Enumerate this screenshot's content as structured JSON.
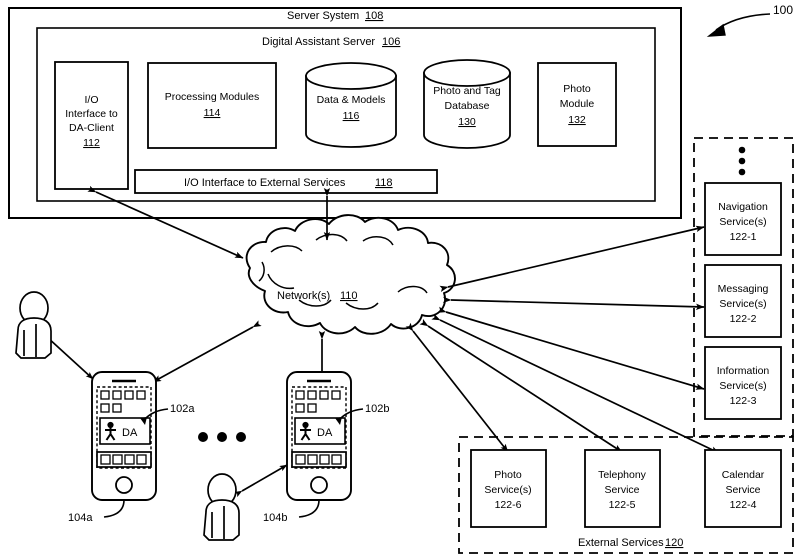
{
  "figure": {
    "number": "100",
    "title_reference": "100"
  },
  "server_system": {
    "label": "Server System",
    "ref": "108"
  },
  "digital_assistant_server": {
    "label": "Digital Assistant Server",
    "ref": "106"
  },
  "da_server_components": [
    {
      "name": "io-interface-da-client",
      "lines": [
        "I/O",
        "Interface to",
        "DA-Client"
      ],
      "ref": "112",
      "shape": "rect"
    },
    {
      "name": "processing-modules",
      "lines": [
        "Processing Modules"
      ],
      "ref": "114",
      "shape": "rect"
    },
    {
      "name": "data-and-models",
      "lines": [
        "Data & Models"
      ],
      "ref": "116",
      "shape": "cylinder"
    },
    {
      "name": "photo-and-tag-database",
      "lines": [
        "Photo and Tag",
        "Database"
      ],
      "ref": "130",
      "shape": "cylinder"
    },
    {
      "name": "photo-module",
      "lines": [
        "Photo",
        "Module"
      ],
      "ref": "132",
      "shape": "rect"
    }
  ],
  "io_interface_external": {
    "label": "I/O Interface to External Services",
    "ref": "118"
  },
  "network": {
    "label": "Network(s)",
    "ref": "110"
  },
  "external_services": {
    "label": "External Services",
    "ref": "120",
    "ellipsis": "vertical-dots",
    "column_services": [
      {
        "name": "navigation-service",
        "lines": [
          "Navigation",
          "Service(s)"
        ],
        "ref": "122-1"
      },
      {
        "name": "messaging-service",
        "lines": [
          "Messaging",
          "Service(s)"
        ],
        "ref": "122-2"
      },
      {
        "name": "information-service",
        "lines": [
          "Information",
          "Service(s)"
        ],
        "ref": "122-3"
      }
    ],
    "row_services": [
      {
        "name": "photo-service",
        "lines": [
          "Photo",
          "Service(s)"
        ],
        "ref": "122-6"
      },
      {
        "name": "telephony-service",
        "lines": [
          "Telephony",
          "Service"
        ],
        "ref": "122-5"
      },
      {
        "name": "calendar-service",
        "lines": [
          "Calendar",
          "Service"
        ],
        "ref": "122-4"
      }
    ]
  },
  "client_devices": [
    {
      "name": "device-a",
      "da_label": "DA",
      "da_ref": "102a",
      "device_ref": "104a"
    },
    {
      "name": "device-b",
      "da_label": "DA",
      "da_ref": "102b",
      "device_ref": "104b"
    }
  ],
  "devices_ellipsis": "horizontal-dots",
  "users": [
    {
      "name": "user-left"
    },
    {
      "name": "user-center"
    }
  ],
  "colors": {
    "stroke": "#000000",
    "background": "#ffffff"
  }
}
